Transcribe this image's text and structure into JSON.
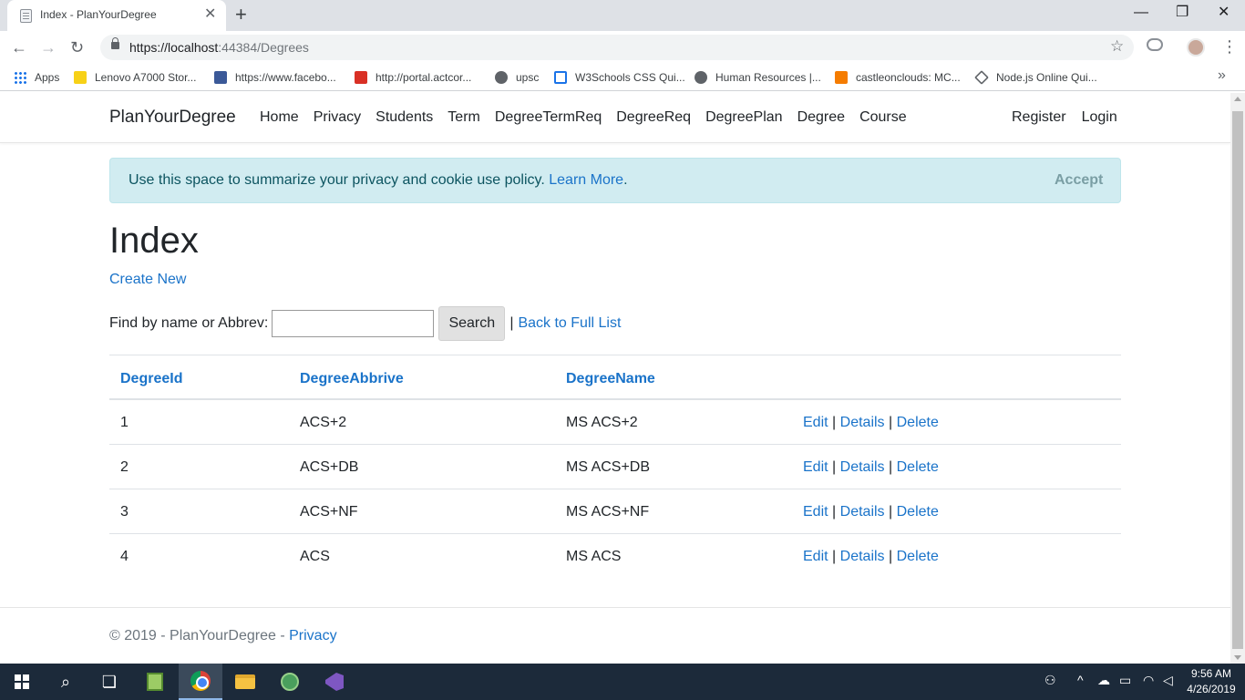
{
  "browser": {
    "tab_title": "Index - PlanYourDegree",
    "url_host": "https://localhost",
    "url_rest": ":44384/Degrees",
    "bookmarks": [
      {
        "label": "Apps",
        "icon": "apps-grid-icon",
        "color": "#1a73e8"
      },
      {
        "label": "Lenovo A7000 Stor...",
        "icon": "flipkart-icon",
        "color": "#f7d117"
      },
      {
        "label": "https://www.facebo...",
        "icon": "facebook-icon",
        "color": "#3b5998"
      },
      {
        "label": "http://portal.actcor...",
        "icon": "act-icon",
        "color": "#d93025"
      },
      {
        "label": "upsc",
        "icon": "globe-icon",
        "color": "#5f6368"
      },
      {
        "label": "W3Schools CSS Qui...",
        "icon": "w3schools-icon",
        "color": "#1a73e8"
      },
      {
        "label": "Human Resources |...",
        "icon": "globe-icon",
        "color": "#5f6368"
      },
      {
        "label": "castleonclouds: MC...",
        "icon": "blogger-icon",
        "color": "#f57c00"
      },
      {
        "label": "Node.js Online Qui...",
        "icon": "nodejs-icon",
        "color": "#5f6368"
      }
    ]
  },
  "site": {
    "brand": "PlanYourDegree",
    "nav": [
      "Home",
      "Privacy",
      "Students",
      "Term",
      "DegreeTermReq",
      "DegreeReq",
      "DegreePlan",
      "Degree",
      "Course"
    ],
    "nav_right": [
      "Register",
      "Login"
    ]
  },
  "cookie": {
    "text": "Use this space to summarize your privacy and cookie use policy.",
    "learn_more": "Learn More",
    "accept": "Accept"
  },
  "main": {
    "title": "Index",
    "create_new": "Create New",
    "search_label": "Find by name or Abbrev:",
    "search_value": "",
    "search_button": "Search",
    "separator": "|",
    "back_link": "Back to Full List"
  },
  "table": {
    "headers": [
      "DegreeId",
      "DegreeAbbrive",
      "DegreeName"
    ],
    "rows": [
      {
        "id": "1",
        "abbrev": "ACS+2",
        "name": "MS ACS+2"
      },
      {
        "id": "2",
        "abbrev": "ACS+DB",
        "name": "MS ACS+DB"
      },
      {
        "id": "3",
        "abbrev": "ACS+NF",
        "name": "MS ACS+NF"
      },
      {
        "id": "4",
        "abbrev": "ACS",
        "name": "MS ACS"
      }
    ],
    "actions": {
      "edit": "Edit",
      "details": "Details",
      "delete": "Delete",
      "sep": "|"
    }
  },
  "footer": {
    "text": "© 2019 - PlanYourDegree -",
    "privacy": "Privacy"
  },
  "taskbar": {
    "time": "9:56 AM",
    "date": "4/26/2019"
  }
}
